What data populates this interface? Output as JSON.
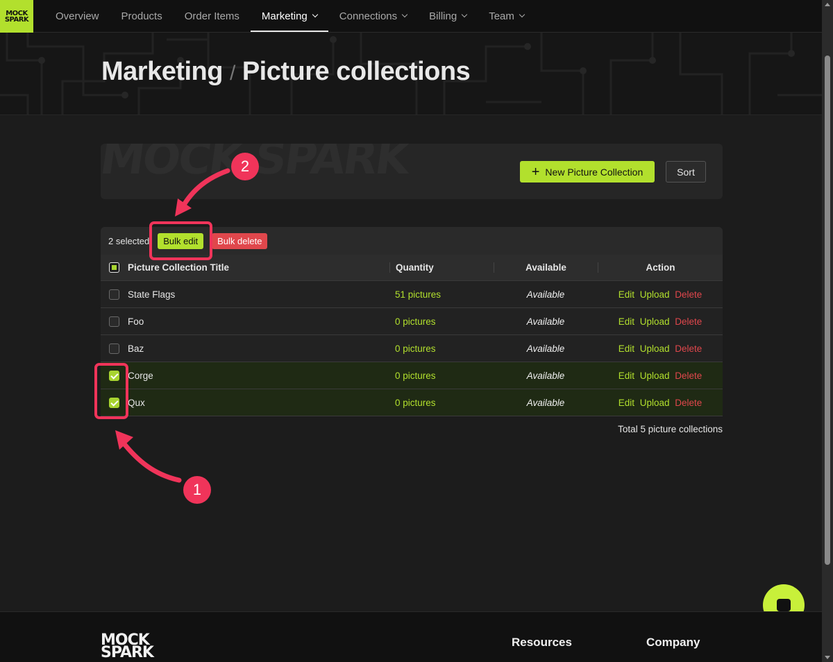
{
  "brand": {
    "logo_line1": "MOCK",
    "logo_line2": "SPARK",
    "accent": "#b2e02d",
    "danger": "#e0474c",
    "annotation": "#f0345a"
  },
  "nav": {
    "items": [
      {
        "label": "Overview"
      },
      {
        "label": "Products"
      },
      {
        "label": "Order Items"
      },
      {
        "label": "Marketing",
        "active": true
      },
      {
        "label": "Connections"
      },
      {
        "label": "Billing"
      },
      {
        "label": "Team"
      }
    ]
  },
  "header": {
    "section": "Marketing",
    "separator": "/",
    "title": "Picture collections"
  },
  "toolbar": {
    "watermark": "MOCK SPARK",
    "new_button": "New Picture Collection",
    "sort_button": "Sort"
  },
  "selection": {
    "count_text": "2 selected",
    "bulk_edit": "Bulk edit",
    "bulk_delete": "Bulk delete"
  },
  "table": {
    "columns": [
      "Picture Collection Title",
      "Quantity",
      "Available",
      "Action"
    ],
    "rows": [
      {
        "title": "State Flags",
        "quantity": "51 pictures",
        "available": "Available",
        "checked": false
      },
      {
        "title": "Foo",
        "quantity": "0 pictures",
        "available": "Available",
        "checked": false
      },
      {
        "title": "Baz",
        "quantity": "0 pictures",
        "available": "Available",
        "checked": false
      },
      {
        "title": "Corge",
        "quantity": "0 pictures",
        "available": "Available",
        "checked": true
      },
      {
        "title": "Qux",
        "quantity": "0 pictures",
        "available": "Available",
        "checked": true
      }
    ],
    "actions": {
      "edit": "Edit",
      "upload": "Upload",
      "delete": "Delete"
    },
    "total": "Total 5 picture collections"
  },
  "annotations": {
    "step1": "1",
    "step2": "2"
  },
  "footer": {
    "logo_line1": "MOCK",
    "logo_line2": "SPARK",
    "col1": "Resources",
    "col2": "Company"
  }
}
